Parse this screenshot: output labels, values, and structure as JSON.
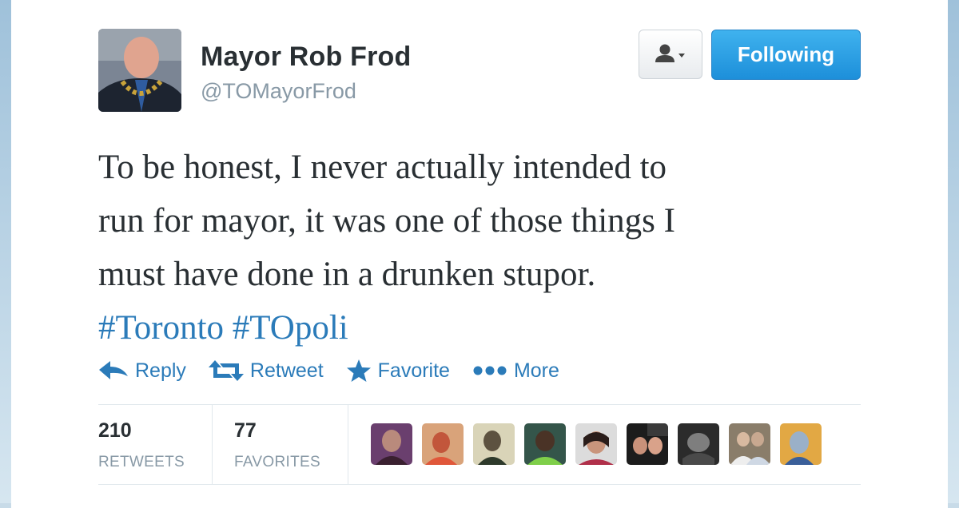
{
  "tweet": {
    "author_name": "Mayor Rob Frod",
    "author_handle": "@TOMayorFrod",
    "follow_label": "Following",
    "text_lines": [
      "To be honest, I never actually intended to",
      "run for mayor, it was one of those things I",
      "must have done in a drunken stupor."
    ],
    "hashtags": [
      "#Toronto",
      "#TOpoli"
    ],
    "actions": {
      "reply": "Reply",
      "retweet": "Retweet",
      "favorite": "Favorite",
      "more": "More"
    },
    "stats": {
      "retweets_count": "210",
      "retweets_label": "RETWEETS",
      "favorites_count": "77",
      "favorites_label": "FAVORITES"
    }
  },
  "colors": {
    "link": "#2b7bb9",
    "follow_button": "#1d8fda",
    "text": "#292f33",
    "muted": "#8899a6",
    "background": "#c8dbe8"
  },
  "icons": [
    "person-dropdown-icon",
    "reply-icon",
    "retweet-icon",
    "star-icon",
    "more-dots-icon"
  ]
}
